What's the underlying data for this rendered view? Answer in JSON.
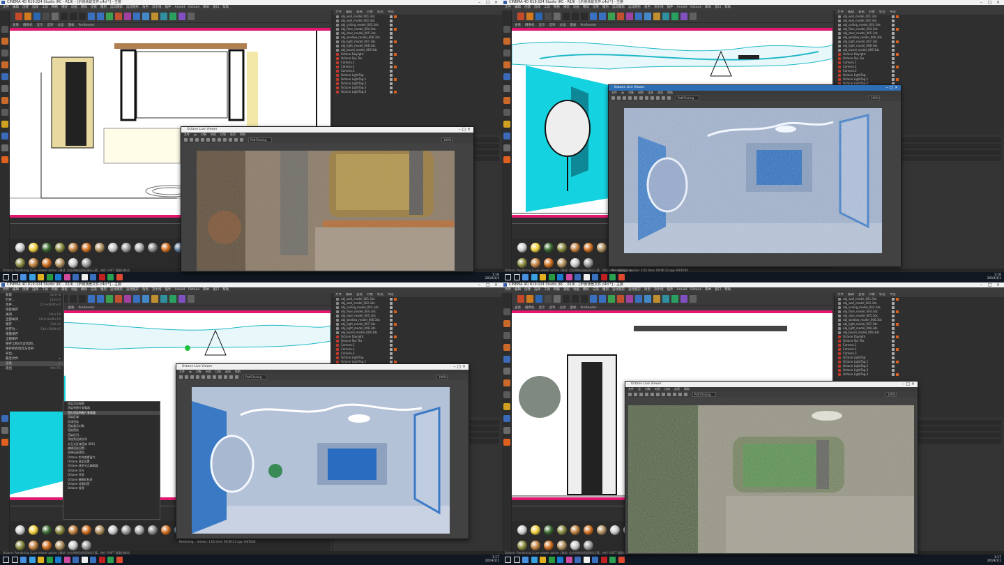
{
  "app_title": "CINEMA 4D R19.024 Studio (RC - R19) - [示例场景文件.c4d *] - 主要",
  "menu_items": [
    "文件",
    "编辑",
    "创建",
    "选择",
    "工具",
    "网格",
    "捕捉",
    "动画",
    "模拟",
    "渲染",
    "雕刻",
    "运动跟踪",
    "运动图形",
    "角色",
    "流水线",
    "插件",
    "Arnold",
    "Octane",
    "脚本",
    "窗口",
    "帮助"
  ],
  "viewport_menu": [
    "查看",
    "摄像机",
    "显示",
    "选项",
    "过滤",
    "面板",
    "ProRender"
  ],
  "object_panel": {
    "menu": [
      "文件",
      "编辑",
      "查看",
      "对象",
      "标签",
      "书签"
    ],
    "rows": [
      "obj_wall_model_001.3ds",
      "obj_wall_model_002.3ds",
      "obj_ceiling_model_003.3ds",
      "obj_floor_model_004.3ds",
      "obj_door_model_005.3ds",
      "obj_window_model_006.3ds",
      "obj_light_model_007.3ds",
      "obj_light_model_008.3ds",
      "obj_board_model_009.3ds",
      "Octane Daylight",
      "Octane Sky Tex",
      "Camera.1",
      "Camera.2",
      "Camera.3",
      "Octane LightTag",
      "Octane LightTag.1",
      "Octane LightTag.2",
      "Octane LightTag.3",
      "Octane LightTag.4"
    ]
  },
  "render_window": {
    "title": "Octane Live Viewer",
    "menu": [
      "文件",
      "云",
      "对象",
      "材质",
      "比较",
      "选项",
      "帮助"
    ],
    "mode_label": "PathTracing",
    "zoom": "100%",
    "status": "Rendering... ms/sec: 1.61  time: 00:00:12  spp: 64/1024"
  },
  "context_menu": {
    "items": [
      "渲染活动视图",
      "渲染到图片查看器",
      "团队渲染到图片查看器",
      "渲染区域",
      "区域渲染",
      "渲染激活对象",
      "渲染预览",
      "渲染队列…",
      "添加到渲染队列",
      "交互式区域渲染 (IRR)",
      "编辑渲染设置…",
      "创建动画预览…",
      "Octane 实时查看窗口",
      "Octane 渲染设置",
      "Octane 材质节点编辑器",
      "Octane 灯光",
      "Octane 环境",
      "Octane 摄像机标签",
      "Octane 对象标签",
      "Octane 纹理"
    ],
    "selected_index": 2
  },
  "side_menu": {
    "items": [
      {
        "label": "新建",
        "key": "Ctrl+N"
      },
      {
        "label": "打开…",
        "key": "Ctrl+O"
      },
      {
        "label": "合并…",
        "key": "Ctrl+Shift+O"
      },
      {
        "label": "恢复保存",
        "key": ""
      },
      {
        "label": "关闭",
        "key": "Ctrl+F4"
      },
      {
        "label": "全部关闭",
        "key": "Ctrl+Shift+F4"
      },
      {
        "label": "保存",
        "key": "Ctrl+S"
      },
      {
        "label": "另存为…",
        "key": "Ctrl+Shift+S"
      },
      {
        "label": "增量保存",
        "key": ""
      },
      {
        "label": "全部保存",
        "key": ""
      },
      {
        "label": "保存工程(包含资源)…",
        "key": ""
      },
      {
        "label": "保存所有场次与合并",
        "key": ""
      },
      {
        "label": "导出…",
        "key": ""
      },
      {
        "label": "最近文件",
        "key": "▸"
      },
      {
        "label": "渲染",
        "key": "▸"
      },
      {
        "label": "退出",
        "key": "Alt+F4"
      }
    ],
    "selected_index": 14
  },
  "status_text": "Octane: Rendering  |  Live viewer active  |  移动: 点击并拖动鼠标移动元素。按住 SHIFT 键量化移动",
  "taskbar": {
    "quadrants": [
      {
        "time": "1:16",
        "date": "2019/1/1"
      },
      {
        "time": "1:16",
        "date": "2019/1/1"
      },
      {
        "time": "1:17",
        "date": "2019/1/1"
      },
      {
        "time": "1:17",
        "date": "2019/1/1"
      }
    ]
  },
  "colors": {
    "accent_pink": "#e3176f",
    "render_blue": "#2d6eb5",
    "cyan_panel": "#14d2e0"
  }
}
